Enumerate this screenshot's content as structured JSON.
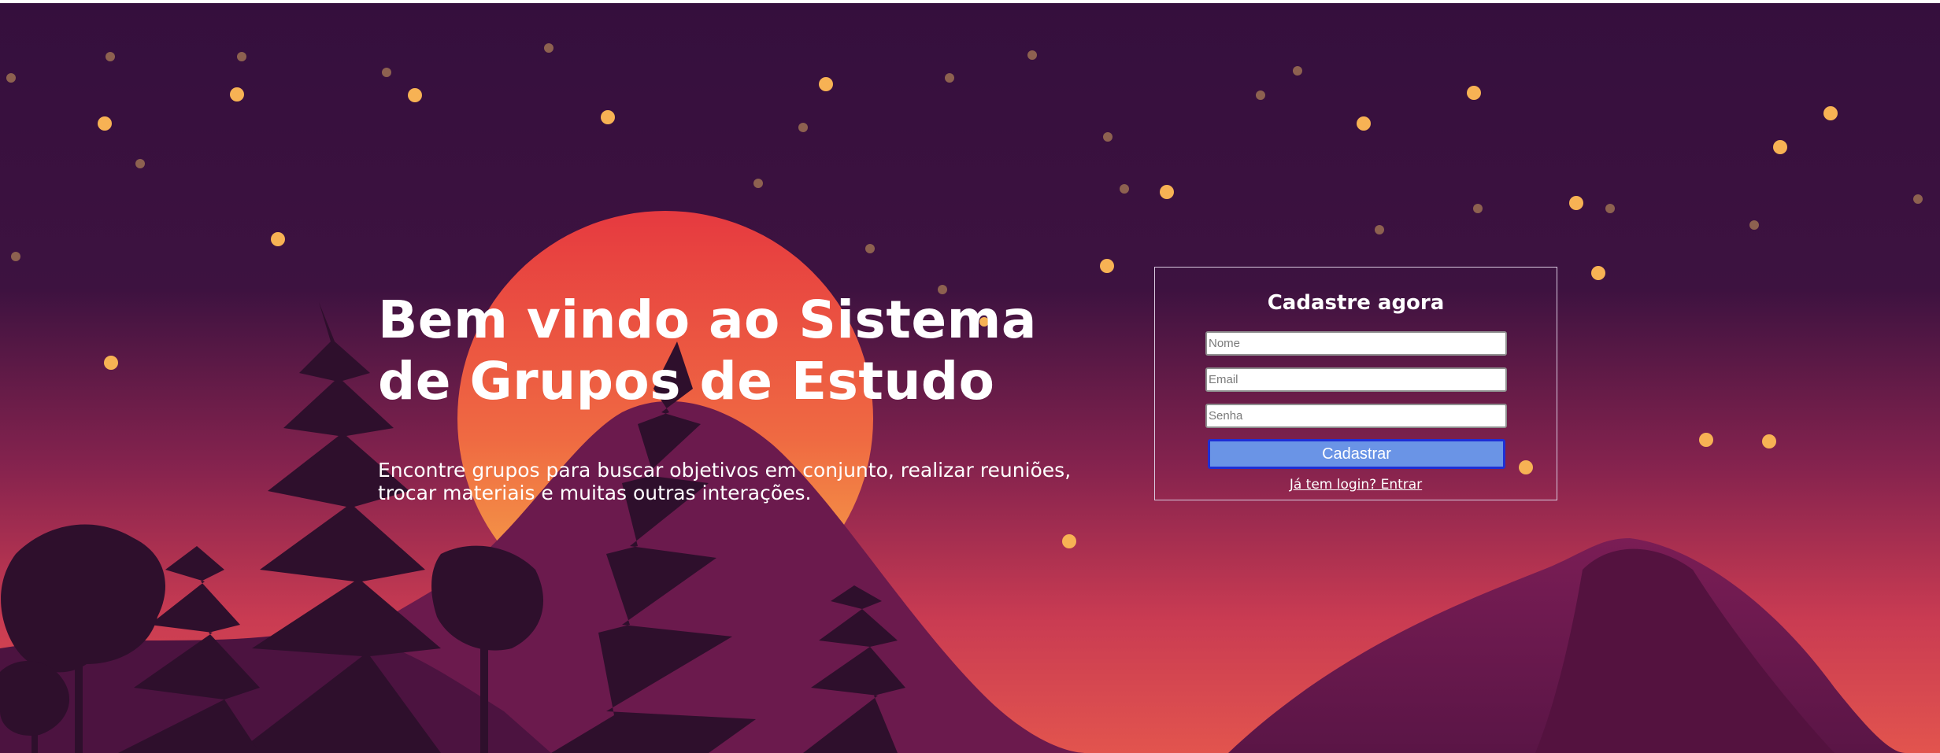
{
  "hero": {
    "title": "Bem vindo ao Sistema de Grupos de Estudo",
    "subtitle": "Encontre grupos para buscar objetivos em conjunto, realizar reuniões, trocar materiais e muitas outras interações."
  },
  "signup_form": {
    "title": "Cadastre agora",
    "name_placeholder": "Nome",
    "email_placeholder": "Email",
    "password_placeholder": "Senha",
    "submit_label": "Cadastrar",
    "login_link": "Já tem login? Entrar"
  },
  "colors": {
    "sky": "#37103f",
    "sun": "#ea4a3f",
    "sun_glow": "#f5a547",
    "star": "#f7b254",
    "mountain": "#6b1a4d",
    "tree": "#2e0f2c",
    "button": "#6a94e6",
    "button_border": "#1e2fd6"
  }
}
